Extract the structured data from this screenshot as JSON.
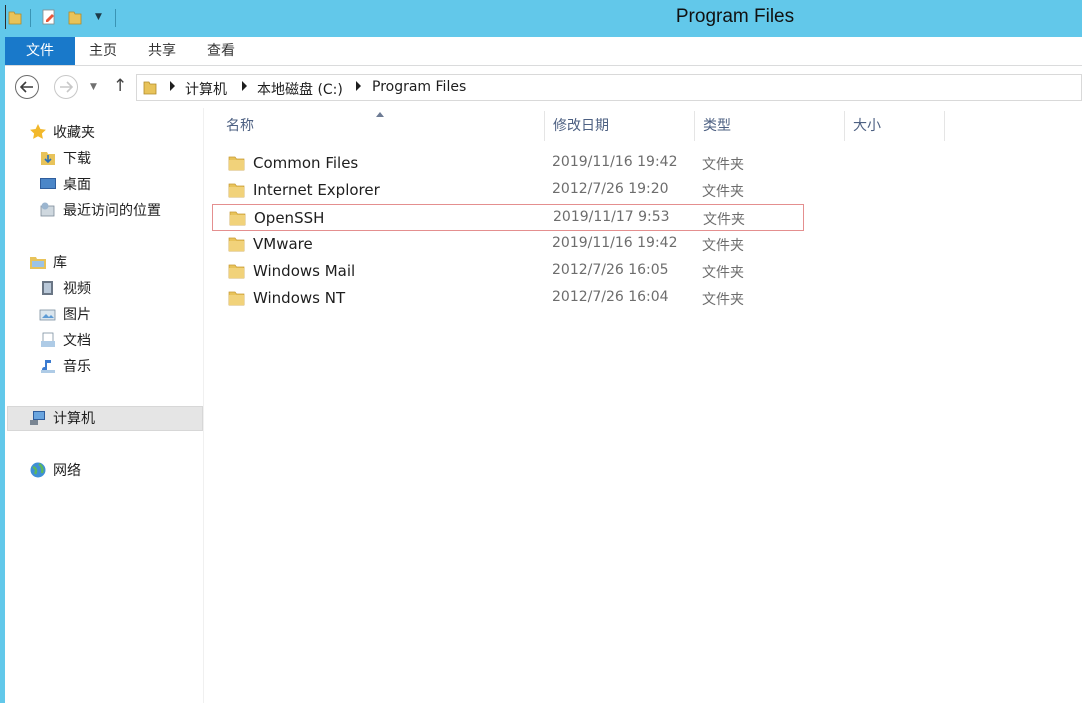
{
  "window": {
    "title": "Program Files"
  },
  "ribbon": {
    "tabs": [
      {
        "label": "文件",
        "active": true
      },
      {
        "label": "主页"
      },
      {
        "label": "共享"
      },
      {
        "label": "查看"
      }
    ]
  },
  "address": {
    "crumbs": [
      "计算机",
      "本地磁盘 (C:)",
      "Program Files"
    ]
  },
  "navpane": {
    "favorites": {
      "label": "收藏夹",
      "items": [
        "下载",
        "桌面",
        "最近访问的位置"
      ]
    },
    "libraries": {
      "label": "库",
      "items": [
        "视频",
        "图片",
        "文档",
        "音乐"
      ]
    },
    "computer": {
      "label": "计算机",
      "selected": true
    },
    "network": {
      "label": "网络"
    }
  },
  "columns": {
    "name": "名称",
    "modified": "修改日期",
    "type": "类型",
    "size": "大小"
  },
  "files": [
    {
      "name": "Common Files",
      "modified": "2019/11/16 19:42",
      "type": "文件夹"
    },
    {
      "name": "Internet Explorer",
      "modified": "2012/7/26 19:20",
      "type": "文件夹"
    },
    {
      "name": "OpenSSH",
      "modified": "2019/11/17 9:53",
      "type": "文件夹",
      "highlighted": true
    },
    {
      "name": "VMware",
      "modified": "2019/11/16 19:42",
      "type": "文件夹"
    },
    {
      "name": "Windows Mail",
      "modified": "2012/7/26 16:05",
      "type": "文件夹"
    },
    {
      "name": "Windows NT",
      "modified": "2012/7/26 16:04",
      "type": "文件夹"
    }
  ],
  "colors": {
    "titlebar": "#62c8ea",
    "file_tab": "#1979ca",
    "highlight_border": "#e48f8f",
    "folder": "#e8c35a"
  }
}
